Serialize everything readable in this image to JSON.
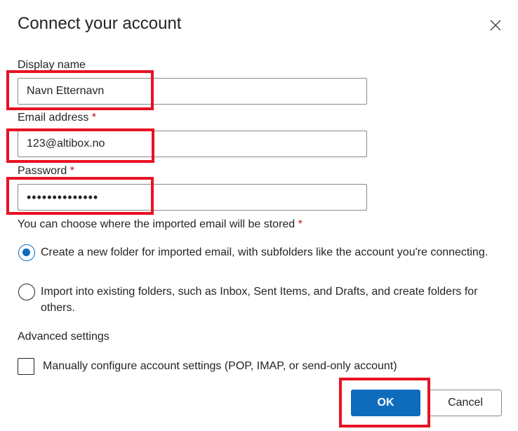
{
  "dialog": {
    "title": "Connect your account"
  },
  "fields": {
    "display_name": {
      "label": "Display name",
      "value": "Navn Etternavn"
    },
    "email": {
      "label": "Email address",
      "required_mark": "*",
      "value": "123@altibox.no"
    },
    "password": {
      "label": "Password",
      "required_mark": "*",
      "value": "••••••••••••••"
    }
  },
  "storage": {
    "question": "You can choose where the imported email will be stored",
    "required_mark": "*",
    "options": [
      {
        "label": "Create a new folder for imported email, with subfolders like the account you're connecting.",
        "selected": true
      },
      {
        "label": "Import into existing folders, such as Inbox, Sent Items, and Drafts, and create folders for others.",
        "selected": false
      }
    ]
  },
  "advanced": {
    "heading": "Advanced settings",
    "manual_config_label": "Manually configure account settings (POP, IMAP, or send-only account)",
    "manual_config_checked": false
  },
  "buttons": {
    "ok_label": "OK",
    "cancel_label": "Cancel"
  },
  "colors": {
    "accent": "#0f6cbd",
    "highlight": "#e81123",
    "required": "#c50f1f"
  },
  "icons": {
    "close": "close-icon"
  }
}
